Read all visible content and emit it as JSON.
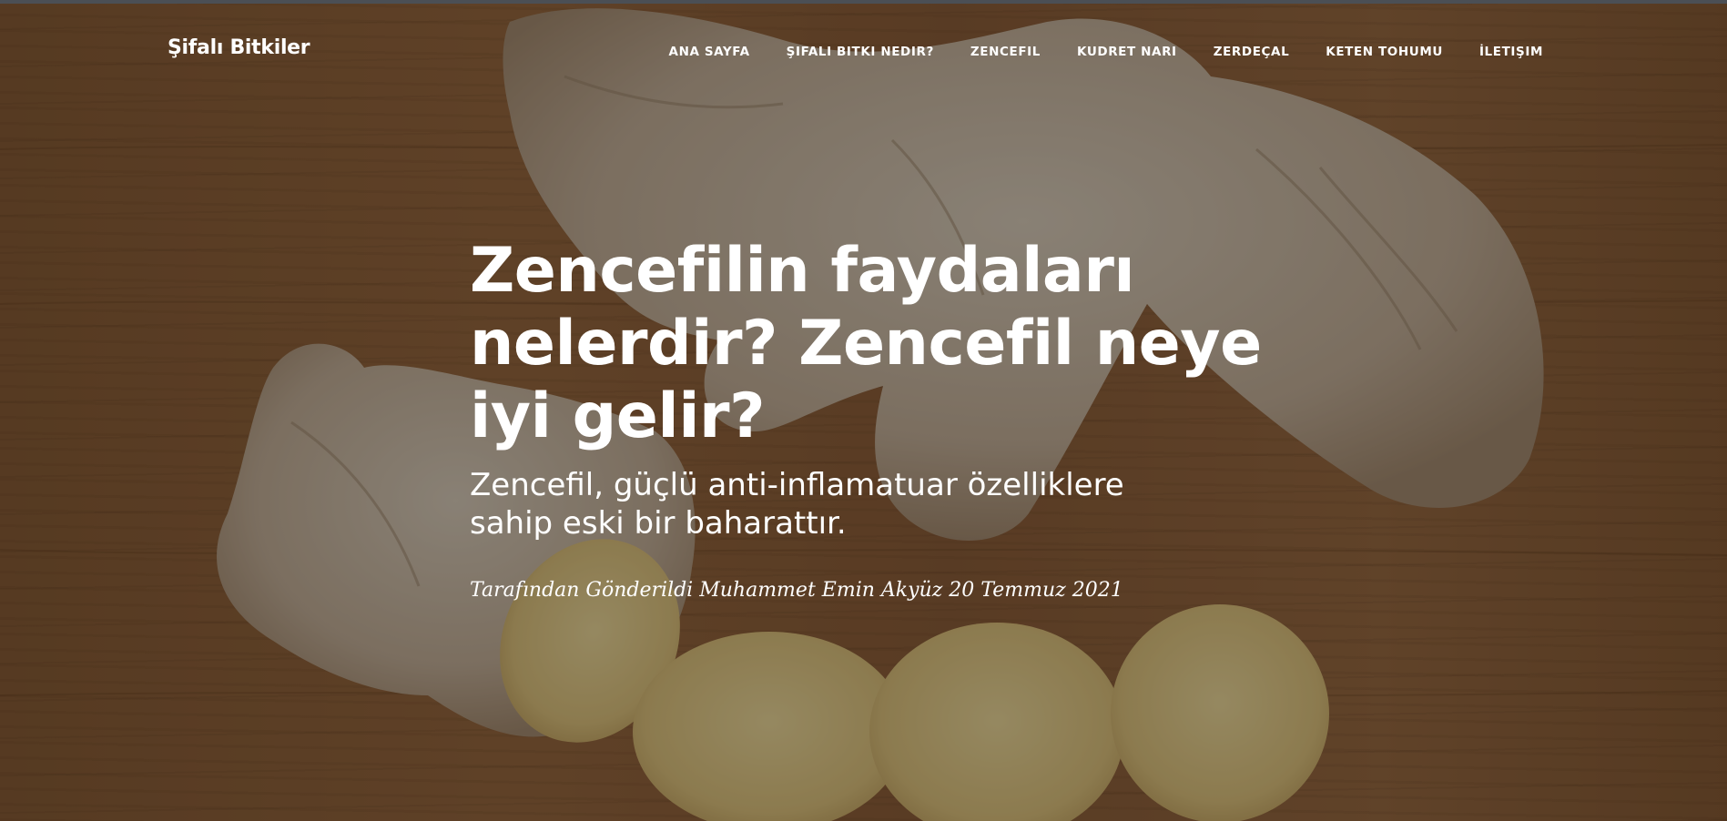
{
  "navbar": {
    "brand": "Şifalı Bitkiler",
    "items": [
      {
        "label": "ANA SAYFA"
      },
      {
        "label": "ŞIFALI BITKI NEDIR?"
      },
      {
        "label": "ZENCEFIL"
      },
      {
        "label": "KUDRET NARI"
      },
      {
        "label": "ZERDEÇAL"
      },
      {
        "label": "KETEN TOHUMU"
      },
      {
        "label": "İLETIŞIM"
      }
    ]
  },
  "post": {
    "title": "Zencefilin faydaları nelerdir? Zencefil neye iyi gelir?",
    "subtitle": "Zencefil, güçlü anti-inflamatuar özelliklere sahip eski bir baharattır.",
    "meta": "Tarafından Gönderildi Muhammet Emin Akyüz 20 Temmuz 2021"
  },
  "colors": {
    "overlay": "#000000",
    "wood": "#8f603a",
    "ginger": "#c9b69c",
    "ginger_slice": "#e3c98a",
    "text": "#ffffff"
  }
}
